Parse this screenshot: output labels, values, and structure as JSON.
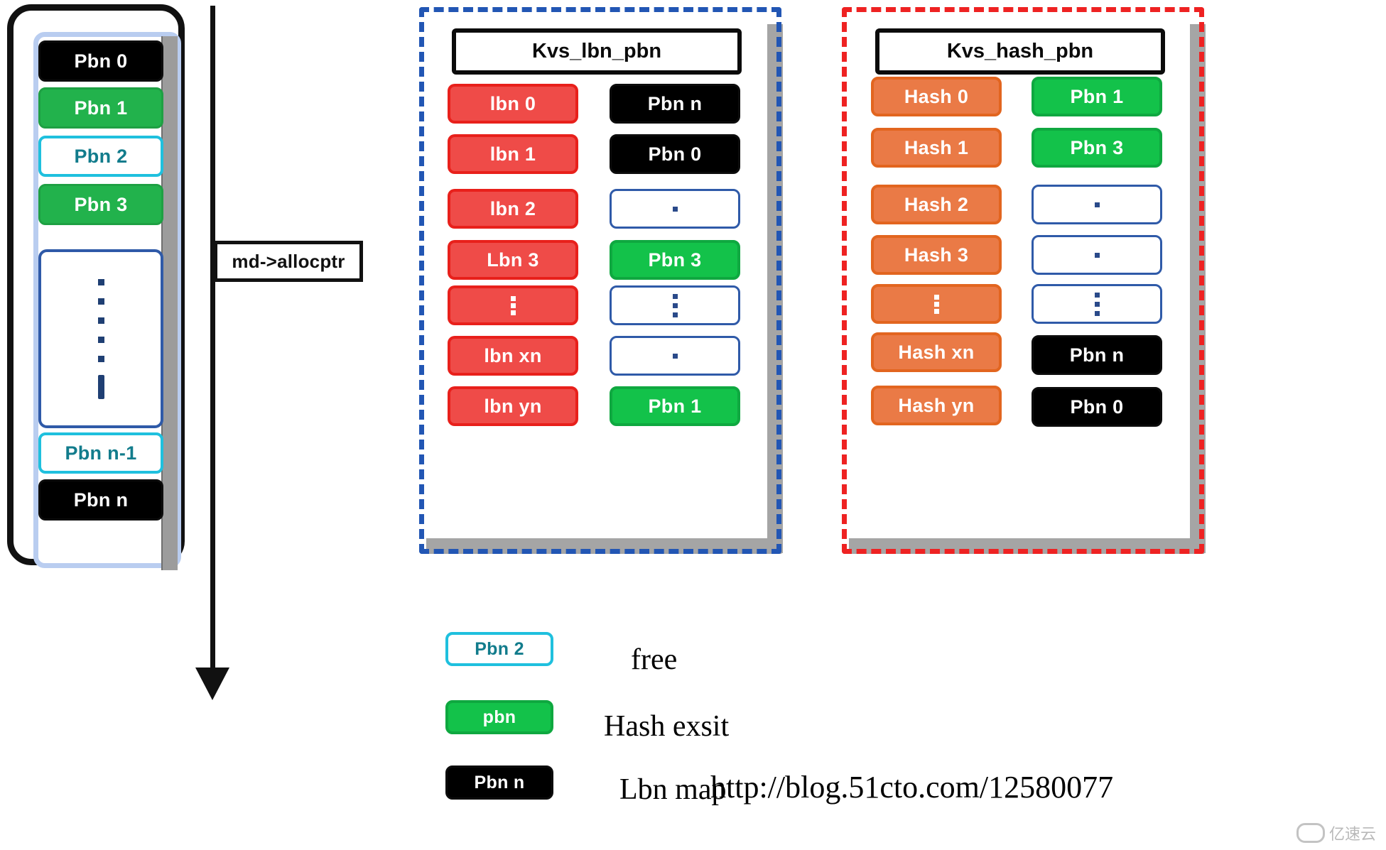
{
  "left_device": {
    "name": "pbn-device-stack",
    "cells": [
      {
        "label": "Pbn 0",
        "style": "black"
      },
      {
        "label": "Pbn 1",
        "style": "green"
      },
      {
        "label": "Pbn 2",
        "style": "free"
      },
      {
        "label": "Pbn 3",
        "style": "green"
      },
      {
        "label": "",
        "style": "ellipsis"
      },
      {
        "label": "Pbn n-1",
        "style": "free"
      },
      {
        "label": "Pbn n",
        "style": "black"
      }
    ]
  },
  "alloc_pointer": {
    "label": "md->allocptr",
    "direction": "down"
  },
  "kvs_lbn_pbn": {
    "title": "Kvs_lbn_pbn",
    "border_color": "#2256b4",
    "keys": [
      {
        "label": "lbn 0",
        "style": "red"
      },
      {
        "label": "lbn 1",
        "style": "red"
      },
      {
        "label": "lbn 2",
        "style": "red"
      },
      {
        "label": "Lbn 3",
        "style": "red"
      },
      {
        "label": "",
        "style": "red-dots"
      },
      {
        "label": "lbn xn",
        "style": "red"
      },
      {
        "label": "lbn yn",
        "style": "red"
      }
    ],
    "values": [
      {
        "label": "Pbn n",
        "style": "black"
      },
      {
        "label": "Pbn 0",
        "style": "black"
      },
      {
        "label": "",
        "style": "empty-dot"
      },
      {
        "label": "Pbn 3",
        "style": "green2"
      },
      {
        "label": "",
        "style": "empty-dots"
      },
      {
        "label": "",
        "style": "empty-dot"
      },
      {
        "label": "Pbn 1",
        "style": "green2"
      }
    ]
  },
  "kvs_hash_pbn": {
    "title": "Kvs_hash_pbn",
    "border_color": "#ee2222",
    "keys": [
      {
        "label": "Hash 0",
        "style": "orange"
      },
      {
        "label": "Hash 1",
        "style": "orange"
      },
      {
        "label": "Hash 2",
        "style": "orange"
      },
      {
        "label": "Hash 3",
        "style": "orange"
      },
      {
        "label": "",
        "style": "orange-dots"
      },
      {
        "label": "Hash xn",
        "style": "orange"
      },
      {
        "label": "Hash yn",
        "style": "orange"
      }
    ],
    "values": [
      {
        "label": "Pbn 1",
        "style": "green2"
      },
      {
        "label": "Pbn 3",
        "style": "green2"
      },
      {
        "label": "",
        "style": "empty-dot"
      },
      {
        "label": "",
        "style": "empty-dot"
      },
      {
        "label": "",
        "style": "empty-dots"
      },
      {
        "label": "Pbn n",
        "style": "black"
      },
      {
        "label": "Pbn 0",
        "style": "black"
      }
    ]
  },
  "legend": [
    {
      "swatch": "Pbn 2",
      "style": "free",
      "text": "free"
    },
    {
      "swatch": "pbn",
      "style": "green2",
      "text": "Hash exsit"
    },
    {
      "swatch": "Pbn n",
      "style": "black",
      "text": "Lbn map"
    }
  ],
  "blog_url": "http://blog.51cto.com/12580077",
  "watermark": "亿速云",
  "colors": {
    "black": "#000000",
    "green": "#22b24c",
    "bright_green": "#13c24a",
    "free_cyan": "#1fc0de",
    "red": "#ef4b48",
    "orange": "#ea7a46",
    "blue_dash": "#2256b4",
    "red_dash": "#ee2222",
    "empty_blue": "#2f5aa8",
    "shadow_gray": "#a5a5a5"
  }
}
